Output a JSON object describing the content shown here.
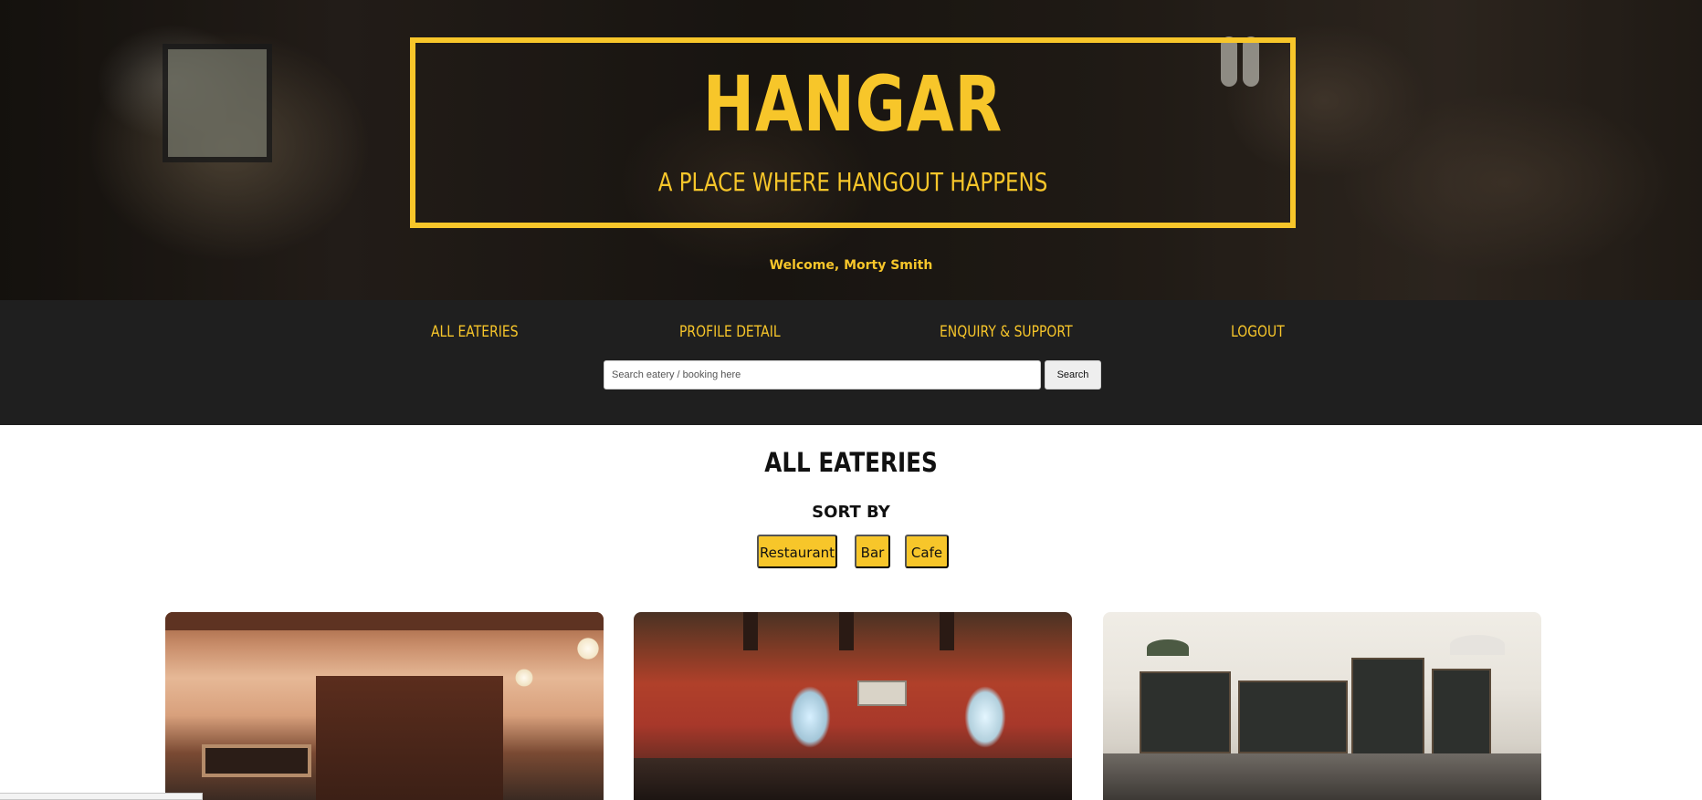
{
  "hero": {
    "title": "HANGAR",
    "subtitle": "A PLACE WHERE HANGOUT HAPPENS",
    "welcome": "Welcome, Morty Smith"
  },
  "nav": {
    "items": [
      {
        "label": "ALL EATERIES"
      },
      {
        "label": "PROFILE DETAIL"
      },
      {
        "label": "ENQUIRY & SUPPORT"
      },
      {
        "label": "LOGOUT"
      }
    ]
  },
  "search": {
    "placeholder": "Search eatery / booking here",
    "value": "",
    "button_label": "Search"
  },
  "main": {
    "section_title": "ALL EATERIES",
    "sort_title": "SORT BY",
    "sort_options": [
      {
        "label": "Restaurant"
      },
      {
        "label": "Bar"
      },
      {
        "label": "Cafe"
      }
    ]
  },
  "theme": {
    "accent": "#f7c62a",
    "nav_background": "#1f1f1f"
  }
}
